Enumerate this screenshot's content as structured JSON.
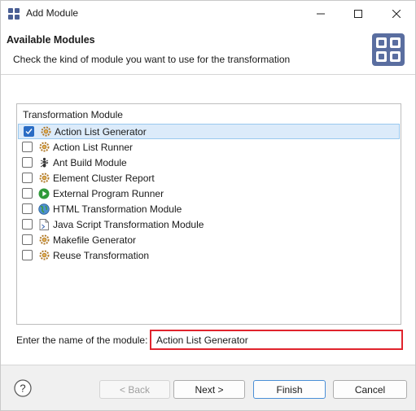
{
  "window": {
    "title": "Add Module",
    "minimize_glyph": "—",
    "maximize_glyph": "☐",
    "close_glyph": "✕"
  },
  "header": {
    "title": "Available Modules",
    "description": "Check the kind of module you want to use for the transformation"
  },
  "module_list": {
    "header": "Transformation Module",
    "items": [
      {
        "label": "Action List Generator",
        "checked": true,
        "selected": true,
        "icon": "gear-icon"
      },
      {
        "label": "Action List Runner",
        "checked": false,
        "selected": false,
        "icon": "gear-icon"
      },
      {
        "label": "Ant Build Module",
        "checked": false,
        "selected": false,
        "icon": "ant-icon"
      },
      {
        "label": "Element Cluster Report",
        "checked": false,
        "selected": false,
        "icon": "gear-icon"
      },
      {
        "label": "External Program Runner",
        "checked": false,
        "selected": false,
        "icon": "play-icon"
      },
      {
        "label": "HTML Transformation Module",
        "checked": false,
        "selected": false,
        "icon": "globe-icon"
      },
      {
        "label": "Java Script Transformation Module",
        "checked": false,
        "selected": false,
        "icon": "script-icon"
      },
      {
        "label": "Makefile Generator",
        "checked": false,
        "selected": false,
        "icon": "gear-icon"
      },
      {
        "label": "Reuse Transformation",
        "checked": false,
        "selected": false,
        "icon": "gear-icon"
      }
    ]
  },
  "module_name": {
    "label": "Enter the name of the module:",
    "value": "Action List Generator"
  },
  "buttons": {
    "help_glyph": "?",
    "back": "< Back",
    "next": "Next >",
    "finish": "Finish",
    "cancel": "Cancel"
  },
  "colors": {
    "selection": "#dcebfa",
    "checkbox_checked": "#2a6cc4",
    "input_highlight": "#e0242d",
    "logo": "#5a6ea0"
  }
}
